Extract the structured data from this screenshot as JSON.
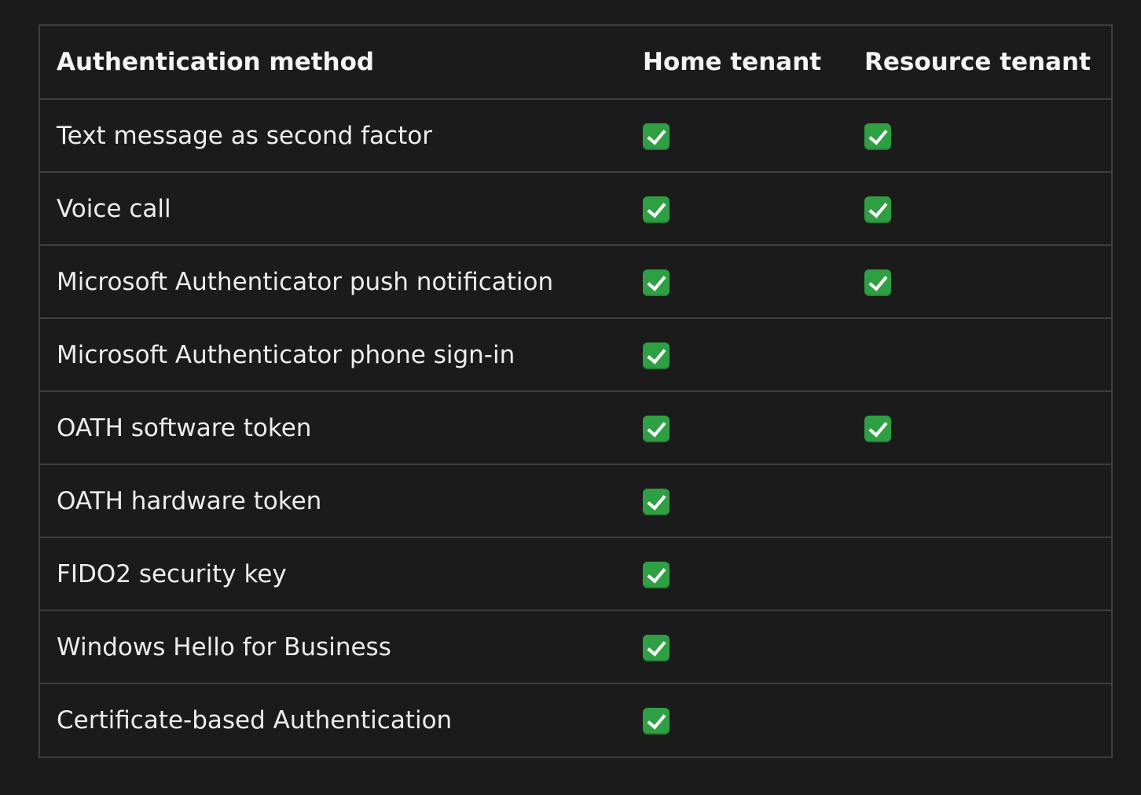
{
  "table": {
    "headers": [
      "Authentication method",
      "Home tenant",
      "Resource tenant"
    ],
    "rows": [
      {
        "method": "Text message as second factor",
        "home": true,
        "resource": true
      },
      {
        "method": "Voice call",
        "home": true,
        "resource": true
      },
      {
        "method": "Microsoft Authenticator push notification",
        "home": true,
        "resource": true
      },
      {
        "method": "Microsoft Authenticator phone sign-in",
        "home": true,
        "resource": false
      },
      {
        "method": "OATH software token",
        "home": true,
        "resource": true
      },
      {
        "method": "OATH hardware token",
        "home": true,
        "resource": false
      },
      {
        "method": "FIDO2 security key",
        "home": true,
        "resource": false
      },
      {
        "method": "Windows Hello for Business",
        "home": true,
        "resource": false
      },
      {
        "method": "Certificate-based Authentication",
        "home": true,
        "resource": false
      }
    ],
    "check_icon": "check-mark-button-icon",
    "check_color": "#2ea043"
  }
}
